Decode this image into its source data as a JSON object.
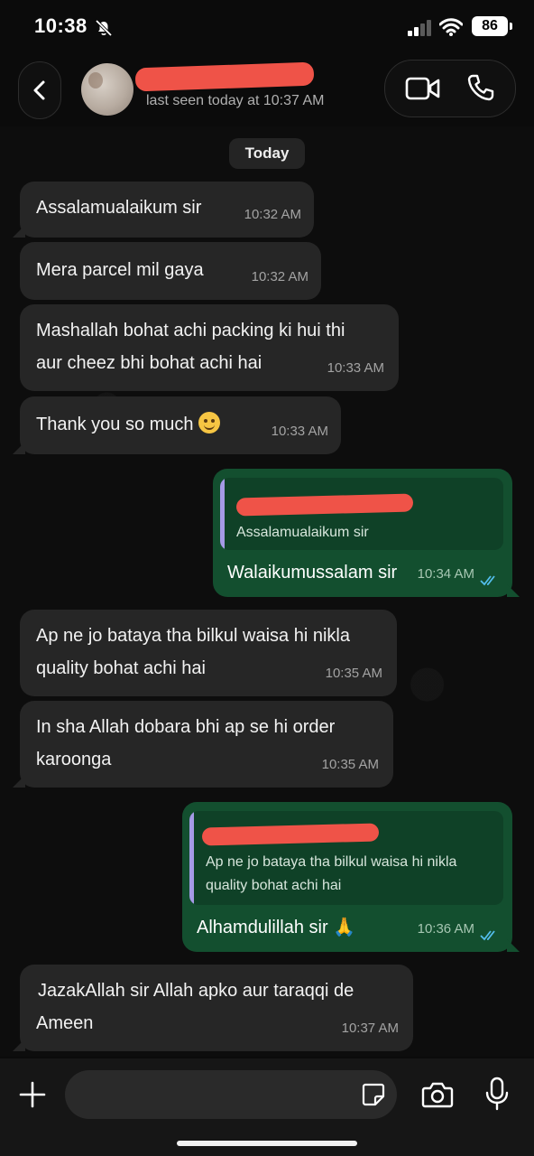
{
  "status_bar": {
    "time": "10:38",
    "battery": "86"
  },
  "header": {
    "last_seen": "last seen today at 10:37 AM"
  },
  "date_chip": "Today",
  "messages": [
    {
      "direction": "in",
      "text": "Assalamualaikum sir",
      "time": "10:32 AM"
    },
    {
      "direction": "in",
      "text": "Mera parcel mil gaya",
      "time": "10:32 AM"
    },
    {
      "direction": "in",
      "line1": "Mashallah bohat achi packing ki hui thi",
      "line2": "aur cheez bhi bohat achi hai",
      "time": "10:33 AM"
    },
    {
      "direction": "in",
      "text": "Thank you so much",
      "time": "10:33 AM"
    },
    {
      "direction": "out",
      "quote": "Assalamualaikum sir",
      "text": "Walaikumussalam sir",
      "time": "10:34 AM"
    },
    {
      "direction": "in",
      "line1": "Ap ne jo bataya tha bilkul waisa hi nikla",
      "line2": "quality bohat achi hai",
      "time": "10:35 AM"
    },
    {
      "direction": "in",
      "line1": "In sha Allah dobara bhi ap se hi order",
      "line2": "karoonga",
      "time": "10:35 AM"
    },
    {
      "direction": "out",
      "quote_line1": "Ap ne jo bataya tha bilkul waisa hi nikla",
      "quote_line2": "quality bohat achi hai",
      "text": "Alhamdulillah sir 🙏",
      "time": "10:36 AM"
    },
    {
      "direction": "in",
      "line1": "JazakAllah sir Allah apko aur taraqqi de",
      "line2": "Ameen",
      "time": "10:37 AM"
    }
  ],
  "input": {
    "value": "",
    "placeholder": ""
  },
  "colors": {
    "incoming_bubble": "#262626",
    "outgoing_bubble": "#134f2f",
    "redaction": "#ef5348",
    "read_ticks": "#53bdeb"
  },
  "icons": [
    "mute-icon",
    "signal-icon",
    "wifi-icon",
    "back-arrow-icon",
    "video-camera-icon",
    "phone-icon",
    "plus-icon",
    "sticker-icon",
    "camera-icon",
    "microphone-icon",
    "double-check-icon",
    "smile-emoji-icon"
  ]
}
